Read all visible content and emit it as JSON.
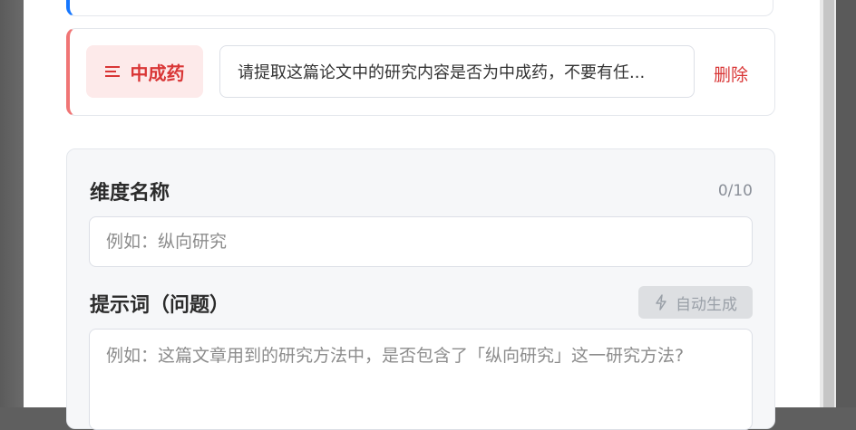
{
  "dimension": {
    "tag_label": "中成药",
    "prompt_text": "请提取这篇论文中的研究内容是否为中成药，不要有任...",
    "delete_label": "删除"
  },
  "form": {
    "name_label": "维度名称",
    "name_counter": "0/10",
    "name_placeholder": "例如：纵向研究",
    "prompt_label": "提示词（问题）",
    "auto_generate_label": "自动生成",
    "prompt_placeholder": "例如：这篇文章用到的研究方法中，是否包含了「纵向研究」这一研究方法?"
  },
  "colors": {
    "accent_blue": "#1677ff",
    "accent_red": "#d93636",
    "tag_bg": "#fdeaea"
  },
  "icons": {
    "tag_icon": "list-icon",
    "auto_icon": "lightning-icon"
  }
}
